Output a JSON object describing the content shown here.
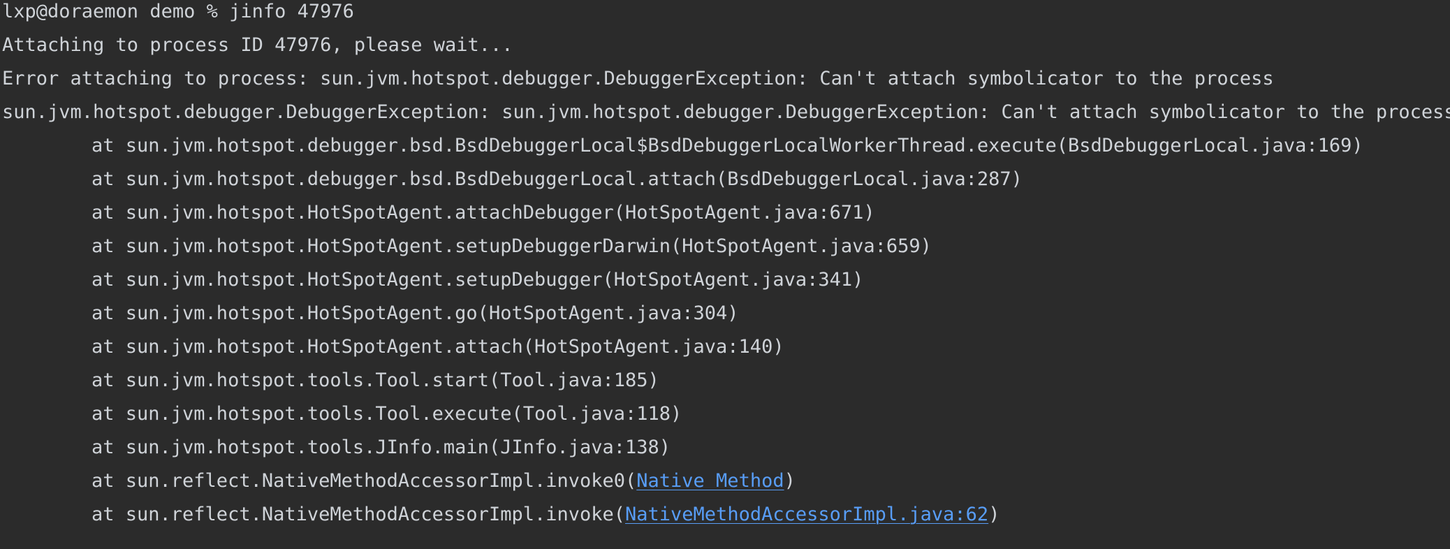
{
  "terminal": {
    "prompt_line": "lxp@doraemon demo % jinfo 47976",
    "lines": [
      "Attaching to process ID 47976, please wait...",
      "Error attaching to process: sun.jvm.hotspot.debugger.DebuggerException: Can't attach symbolicator to the process",
      "sun.jvm.hotspot.debugger.DebuggerException: sun.jvm.hotspot.debugger.DebuggerException: Can't attach symbolicator to the process"
    ],
    "stack": [
      "at sun.jvm.hotspot.debugger.bsd.BsdDebuggerLocal$BsdDebuggerLocalWorkerThread.execute(BsdDebuggerLocal.java:169)",
      "at sun.jvm.hotspot.debugger.bsd.BsdDebuggerLocal.attach(BsdDebuggerLocal.java:287)",
      "at sun.jvm.hotspot.HotSpotAgent.attachDebugger(HotSpotAgent.java:671)",
      "at sun.jvm.hotspot.HotSpotAgent.setupDebuggerDarwin(HotSpotAgent.java:659)",
      "at sun.jvm.hotspot.HotSpotAgent.setupDebugger(HotSpotAgent.java:341)",
      "at sun.jvm.hotspot.HotSpotAgent.go(HotSpotAgent.java:304)",
      "at sun.jvm.hotspot.HotSpotAgent.attach(HotSpotAgent.java:140)",
      "at sun.jvm.hotspot.tools.Tool.start(Tool.java:185)",
      "at sun.jvm.hotspot.tools.Tool.execute(Tool.java:118)",
      "at sun.jvm.hotspot.tools.JInfo.main(JInfo.java:138)"
    ],
    "linked_lines": [
      {
        "prefix": "at sun.reflect.NativeMethodAccessorImpl.invoke0(",
        "link": "Native Method",
        "suffix": ")"
      },
      {
        "prefix": "at sun.reflect.NativeMethodAccessorImpl.invoke(",
        "link": "NativeMethodAccessorImpl.java:62",
        "suffix": ")"
      }
    ]
  },
  "colors": {
    "background": "#2b2b2b",
    "text": "#cfd3d8",
    "link": "#589df6"
  }
}
